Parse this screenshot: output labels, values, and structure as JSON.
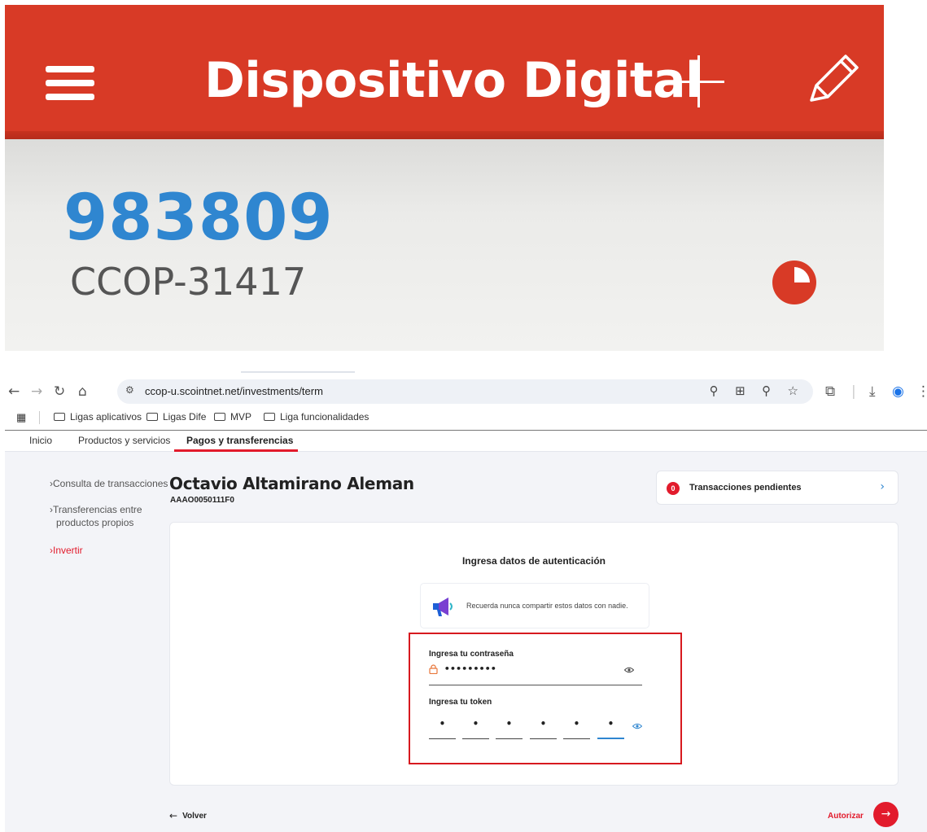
{
  "phone": {
    "title": "Dispositivo Digital",
    "code": "983809",
    "device_id": "CCOP-31417",
    "timer_fraction": 0.75,
    "colors": {
      "header": "#d83a26",
      "code": "#2f86d0"
    },
    "icons": [
      "menu-icon",
      "plus-icon",
      "pencil-icon",
      "timer-icon"
    ]
  },
  "browser": {
    "url": "ccop-u.scointnet.net/investments/term",
    "bookmarks": [
      "Ligas aplicativos",
      "Ligas Dife",
      "MVP",
      "Liga funcionalidades"
    ]
  },
  "nav": {
    "items": [
      "Inicio",
      "Productos y servicios",
      "Pagos y transferencias"
    ],
    "active_index": 2
  },
  "sidebar": {
    "items": [
      {
        "label": "Consulta de transacciones"
      },
      {
        "label": "Transferencias entre",
        "label2": "productos propios"
      },
      {
        "label": "Invertir"
      }
    ]
  },
  "user": {
    "name": "Octavio Altamirano Aleman",
    "id": "AAAO0050111F0"
  },
  "pending": {
    "count": "0",
    "label": "Transacciones pendientes"
  },
  "auth": {
    "title": "Ingresa datos de autenticación",
    "notice": "Recuerda nunca compartir estos datos con nadie.",
    "password_label": "Ingresa tu contraseña",
    "password_value": "•••••••••",
    "token_label": "Ingresa tu token",
    "token_values": [
      "•",
      "•",
      "•",
      "•",
      "•",
      "•"
    ]
  },
  "footer": {
    "back_label": "Volver",
    "authorize_label": "Autorizar"
  },
  "colors": {
    "accent": "#e21b2c",
    "link": "#2f86d0"
  }
}
